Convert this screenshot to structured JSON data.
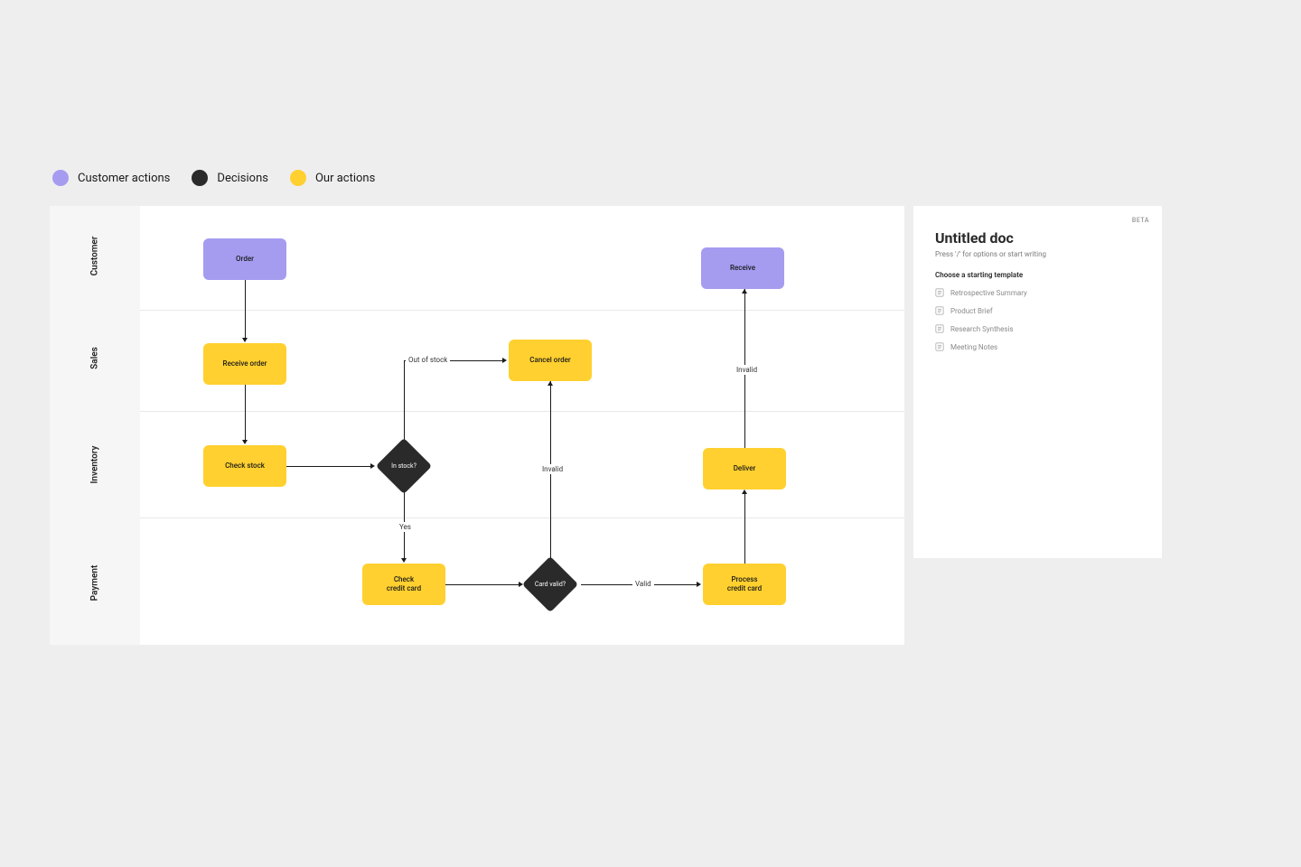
{
  "legend": [
    {
      "label": "Customer actions",
      "color": "#a59cf0"
    },
    {
      "label": "Decisions",
      "color": "#2a2a2a"
    },
    {
      "label": "Our actions",
      "color": "#ffd02f"
    }
  ],
  "lanes": [
    {
      "label": "Customer"
    },
    {
      "label": "Sales"
    },
    {
      "label": "Inventory"
    },
    {
      "label": "Payment"
    }
  ],
  "nodes": {
    "order": {
      "label": "Order"
    },
    "receive": {
      "label": "Receive"
    },
    "receive_order": {
      "label": "Receive order"
    },
    "cancel_order": {
      "label": "Cancel order"
    },
    "check_stock": {
      "label": "Check stock"
    },
    "in_stock": {
      "label": "In stock?"
    },
    "deliver": {
      "label": "Deliver"
    },
    "check_cc": {
      "label": "Check\ncredit card"
    },
    "card_valid": {
      "label": "Card valid?"
    },
    "process_cc": {
      "label": "Process\ncredit card"
    }
  },
  "edges": {
    "out_of_stock": "Out of stock",
    "yes": "Yes",
    "invalid": "Invalid",
    "valid": "Valid",
    "invalid2": "Invalid"
  },
  "doc_panel": {
    "badge": "BETA",
    "title": "Untitled doc",
    "hint": "Press '/' for options or start writing",
    "section_label": "Choose a starting template",
    "templates": [
      {
        "label": "Retrospective Summary"
      },
      {
        "label": "Product Brief"
      },
      {
        "label": "Research Synthesis"
      },
      {
        "label": "Meeting Notes"
      }
    ]
  }
}
